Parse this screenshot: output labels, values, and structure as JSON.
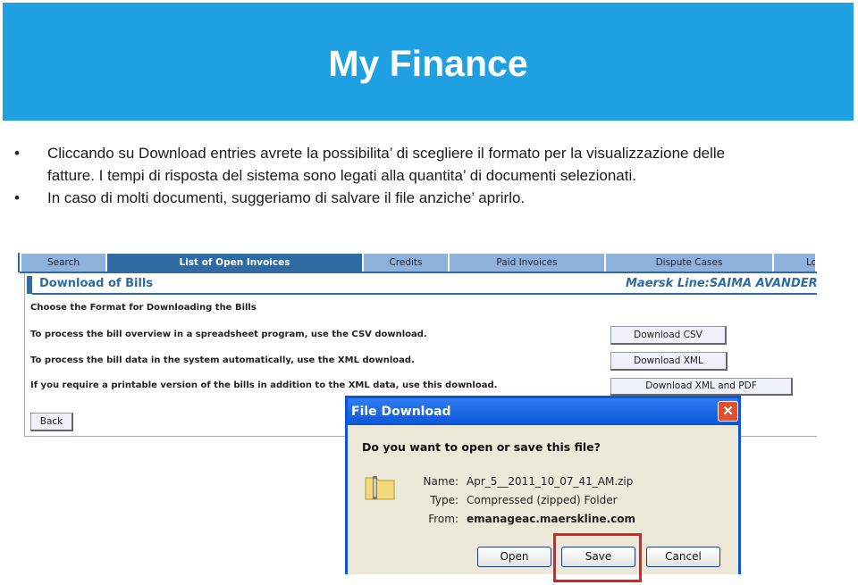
{
  "slide": {
    "title": "My Finance",
    "bullets": [
      {
        "line1": "Cliccando su  Download entries   avrete la possibilita’ di scegliere il formato per la visualizzazione delle",
        "line2": "fatture. I tempi di risposta del sistema sono legati alla quantita’ di documenti selezionati."
      },
      {
        "line1": "In caso di molti documenti, suggeriamo di salvare il file anziche’ aprirlo."
      }
    ],
    "bullet_glyph": "•"
  },
  "web": {
    "tabs": [
      "Search",
      "List of Open Invoices",
      "Credits",
      "Paid Invoices",
      "Dispute Cases",
      "Lo"
    ],
    "active_tab": "List of Open Invoices",
    "section_title": "Download of Bills",
    "account": "Maersk Line:SAIMA AVANDERO",
    "heading": "Choose the Format for Downloading the Bills",
    "rows": [
      {
        "text": "To process the bill overview in a spreadsheet program, use the CSV download.",
        "button": "Download CSV"
      },
      {
        "text": "To process the bill data in the system automatically, use the XML download.",
        "button": "Download XML"
      },
      {
        "text": "If you require a printable version of the bills in addition to the XML data, use this download.",
        "button": "Download XML and PDF"
      }
    ],
    "back": "Back"
  },
  "dialog": {
    "title": "File Download",
    "question": "Do you want to open or save this file?",
    "name_label": "Name:",
    "name": "Apr_5__2011_10_07_41_AM.zip",
    "type_label": "Type:",
    "type": "Compressed (zipped) Folder",
    "from_label": "From:",
    "from": "emanageac.maerskline.com",
    "open": "Open",
    "save": "Save",
    "cancel": "Cancel",
    "close_glyph": "✕",
    "highlight_color": "#e02020"
  }
}
